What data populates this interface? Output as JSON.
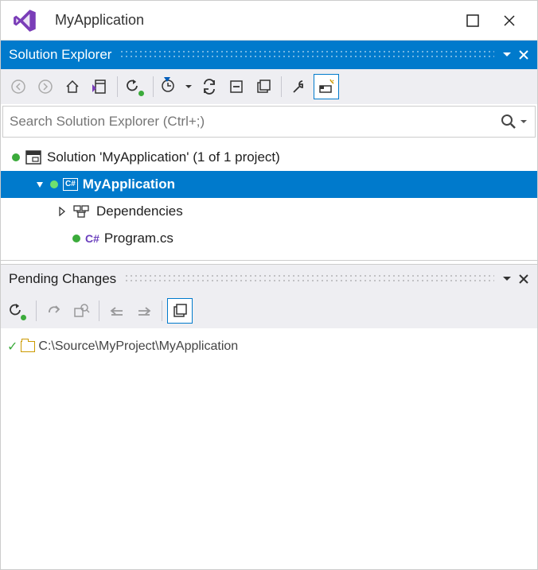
{
  "window": {
    "title": "MyApplication"
  },
  "solution_explorer": {
    "title": "Solution Explorer",
    "search_placeholder": "Search Solution Explorer (Ctrl+;)",
    "solution_label": "Solution 'MyApplication' (1 of 1 project)",
    "project_label": "MyApplication",
    "dependencies_label": "Dependencies",
    "program_label": "Program.cs"
  },
  "pending_changes": {
    "title": "Pending Changes",
    "path": "C:\\Source\\MyProject\\MyApplication"
  }
}
